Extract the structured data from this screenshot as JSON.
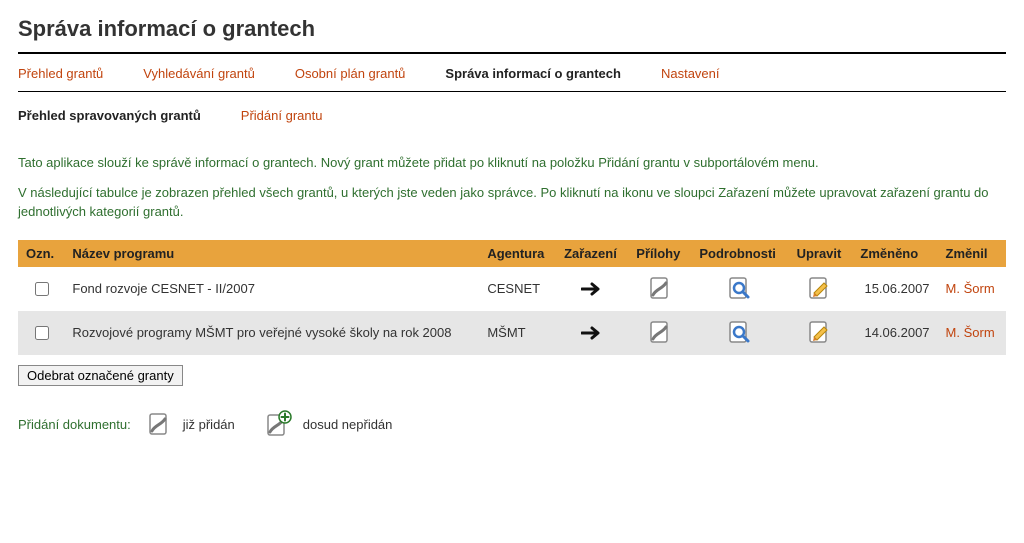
{
  "page_title": "Správa informací o grantech",
  "tabs": [
    {
      "label": "Přehled grantů",
      "active": false
    },
    {
      "label": "Vyhledávání grantů",
      "active": false
    },
    {
      "label": "Osobní plán grantů",
      "active": false
    },
    {
      "label": "Správa informací o grantech",
      "active": true
    },
    {
      "label": "Nastavení",
      "active": false
    }
  ],
  "subtabs": [
    {
      "label": "Přehled spravovaných grantů",
      "active": true
    },
    {
      "label": "Přidání grantu",
      "active": false
    }
  ],
  "intro_p1": "Tato aplikace slouží ke správě informací o grantech. Nový grant můžete přidat po kliknutí na položku Přidání grantu v subportálovém menu.",
  "intro_p2": "V následující tabulce je zobrazen přehled všech grantů, u kterých jste veden jako správce. Po kliknutí na ikonu ve sloupci Zařazení můžete upravovat zařazení grantu do jednotlivých kategorií grantů.",
  "columns": {
    "ozn": "Ozn.",
    "nazev": "Název programu",
    "agentura": "Agentura",
    "zarazeni": "Zařazení",
    "prilohy": "Přílohy",
    "podrobnosti": "Podrobnosti",
    "upravit": "Upravit",
    "zmeneno": "Změněno",
    "zmenil": "Změnil"
  },
  "rows": [
    {
      "nazev": "Fond rozvoje CESNET - II/2007",
      "agentura": "CESNET",
      "zmeneno": "15.06.2007",
      "zmenil": "M. Šorm"
    },
    {
      "nazev": "Rozvojové programy MŠMT pro veřejné vysoké školy na rok 2008",
      "agentura": "MŠMT",
      "zmeneno": "14.06.2007",
      "zmenil": "M. Šorm"
    }
  ],
  "remove_button": "Odebrat označené granty",
  "legend": {
    "label": "Přidání dokumentu:",
    "added": "již přidán",
    "not_added": "dosud nepřidán"
  }
}
